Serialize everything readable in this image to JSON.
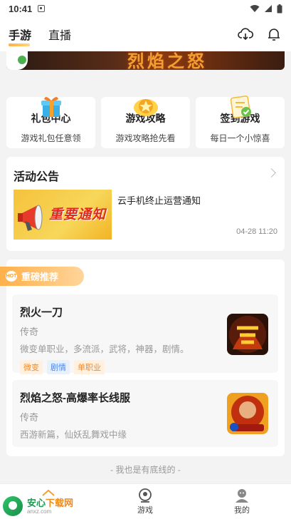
{
  "status_bar": {
    "time": "10:41"
  },
  "top_nav": {
    "tabs": [
      {
        "label": "手游"
      },
      {
        "label": "直播"
      }
    ],
    "icons": [
      "download-cloud-icon",
      "bell-icon"
    ]
  },
  "banner": {
    "text": "烈焰之怒"
  },
  "quick_links": [
    {
      "title": "礼包中心",
      "subtitle": "游戏礼包任意领",
      "icon": "gift-icon"
    },
    {
      "title": "游戏攻略",
      "subtitle": "游戏攻略抢先看",
      "icon": "star-badge-icon"
    },
    {
      "title": "签到游戏",
      "subtitle": "每日一个小惊喜",
      "icon": "checkin-note-icon"
    }
  ],
  "notice": {
    "heading": "活动公告",
    "item": {
      "thumb_label": "重要通知",
      "title": "云手机终止运营通知",
      "time": "04-28 11:20"
    }
  },
  "recommend": {
    "heading": "重磅推荐",
    "badge": "HOT",
    "games": [
      {
        "name": "烈火一刀",
        "genre": "传奇",
        "desc": "微变单职业，多流派，武将，神器，剧情。",
        "tags": [
          "微变",
          "剧情",
          "单职业"
        ]
      },
      {
        "name": "烈焰之怒-高爆率长线服",
        "genre": "传奇",
        "desc": "西游新篇，仙妖乱舞戏中缘",
        "tags": []
      }
    ]
  },
  "footer_text": "- 我也是有底线的 -",
  "bottom_nav": [
    {
      "label": "",
      "icon": "home-icon"
    },
    {
      "label": "游戏",
      "icon": "game-icon"
    },
    {
      "label": "我的",
      "icon": "profile-icon"
    }
  ],
  "watermark": {
    "brand_a": "安心",
    "brand_b": "下载网",
    "site": "anxz.com"
  },
  "colors": {
    "accent": "#f5a030",
    "tag_orange": "#f08a2a",
    "tag_blue": "#4a86e8"
  }
}
